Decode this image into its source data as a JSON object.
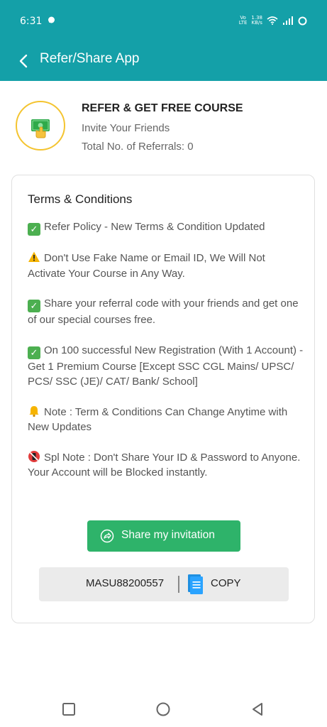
{
  "status_bar": {
    "time": "6:31",
    "network_label": "LTE",
    "speed_value": "1.38",
    "speed_unit": "KB/s"
  },
  "app_bar": {
    "title": "Refer/Share App"
  },
  "referral": {
    "title": "REFER & GET FREE COURSE",
    "subtitle": "Invite Your Friends",
    "count_text": "Total No. of Referrals: 0"
  },
  "terms": {
    "title": "Terms & Conditions",
    "items": [
      {
        "icon": "check-mark-icon",
        "text": "Refer Policy - New Terms & Condition Updated"
      },
      {
        "icon": "warning-icon",
        "text": "Don't Use Fake Name or Email ID, We Will Not Activate Your Course in Any Way."
      },
      {
        "icon": "check-mark-icon",
        "text": "Share your referral code with your friends and get one of our special courses free."
      },
      {
        "icon": "check-mark-icon",
        "text": "On 100 successful New Registration (With 1 Account) - Get 1 Premium Course [Except SSC CGL Mains/ UPSC/ PCS/ SSC (JE)/ CAT/ Bank/ School]"
      },
      {
        "icon": "bell-icon",
        "text": "Note : Term & Conditions Can Change Anytime with New Updates"
      },
      {
        "icon": "no-mobile-phones-icon",
        "text": "Spl Note : Don't Share Your ID & Password to Anyone. Your Account will be Blocked instantly."
      }
    ]
  },
  "share": {
    "button_label": "Share my invitation"
  },
  "code": {
    "value": "MASU88200557",
    "copy_label": "COPY"
  },
  "colors": {
    "primary": "#14a0a8",
    "share_button": "#2eb36a",
    "icon_ring": "#f4c430",
    "code_bar": "#ebebeb"
  }
}
